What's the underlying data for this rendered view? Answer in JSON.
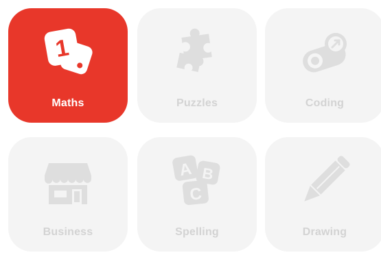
{
  "colors": {
    "active_tile": "#e8372a",
    "inactive_tile": "#f4f4f4",
    "inactive_icon": "#dedede",
    "inactive_label": "#d3d3d3",
    "active_label": "#ffffff"
  },
  "categories": [
    {
      "label": "Maths",
      "icon": "dice-icon",
      "selected": true
    },
    {
      "label": "Puzzles",
      "icon": "puzzle-icon",
      "selected": false
    },
    {
      "label": "Coding",
      "icon": "coding-robot-icon",
      "selected": false
    },
    {
      "label": "Business",
      "icon": "shop-icon",
      "selected": false
    },
    {
      "label": "Spelling",
      "icon": "abc-blocks-icon",
      "selected": false
    },
    {
      "label": "Drawing",
      "icon": "pencil-icon",
      "selected": false
    }
  ]
}
